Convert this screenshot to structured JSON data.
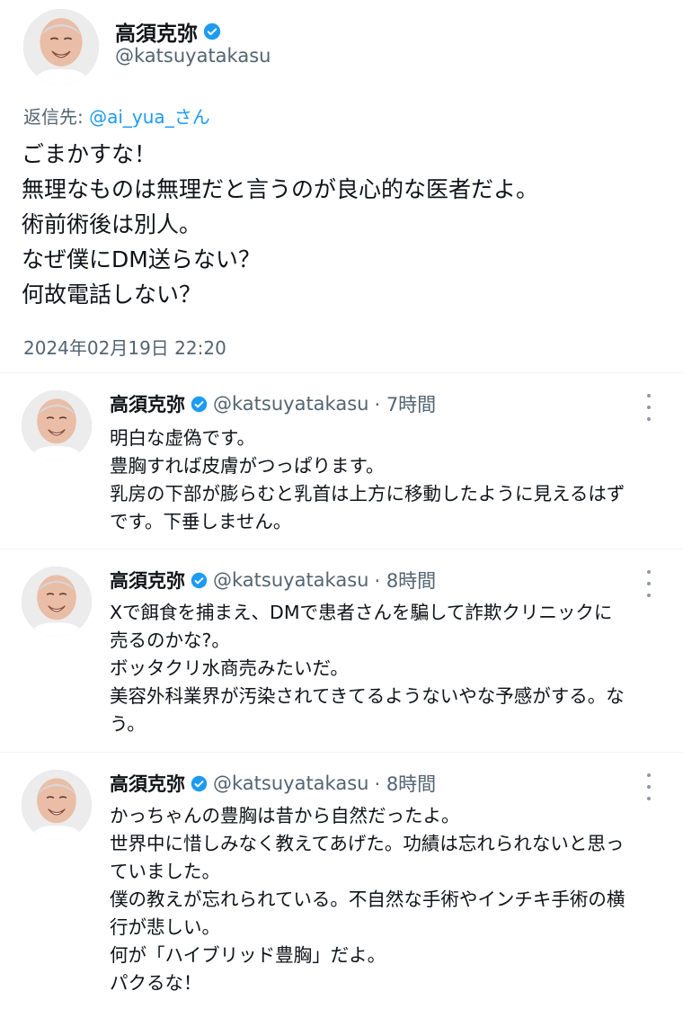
{
  "main_tweet": {
    "name": "高須克弥",
    "handle": "@katsuyatakasu",
    "reply_prefix": "返信先: ",
    "reply_mention": "@ai_yua_さん",
    "lines": [
      "ごまかすな！",
      "無理なものは無理だと言うのが良心的な医者だよ。",
      "術前術後は別人。",
      "なぜ僕にDM送らない？",
      "何故電話しない？"
    ],
    "timestamp": "2024年02月19日 22:20"
  },
  "replies": [
    {
      "name": "高須克弥",
      "handle": "@katsuyatakasu",
      "time": "· 7時間",
      "lines": [
        "明白な虚偽です。",
        "豊胸すれば皮膚がつっぱります。",
        "乳房の下部が膨らむと乳首は上方に移動したように見えるはず",
        "です。下垂しません。"
      ]
    },
    {
      "name": "高須克弥",
      "handle": "@katsuyatakasu",
      "time": "· 8時間",
      "lines": [
        "Xで餌食を捕まえ、DMで患者さんを騙して詐欺クリニックに",
        "売るのかな?。",
        "ボッタクリ水商売みたいだ。",
        "美容外科業界が汚染されてきてるようないやな予感がする。な",
        "う。"
      ]
    },
    {
      "name": "高須克弥",
      "handle": "@katsuyatakasu",
      "time": "· 8時間",
      "lines": [
        "かっちゃんの豊胸は昔から自然だったよ。",
        "世界中に惜しみなく教えてあげた。功績は忘れられないと思っ",
        "ていました。",
        "僕の教えが忘れられている。不自然な手術やインチキ手術の横",
        "行が悲しい。",
        "何が「ハイブリッド豊胸」だよ。",
        "パクるな！"
      ]
    }
  ],
  "icons": {
    "verified": "verified-badge-icon",
    "more": "more-options-icon"
  },
  "colors": {
    "accent": "#1d9bf0",
    "secondary_text": "#536471",
    "primary_text": "#0f1419"
  }
}
